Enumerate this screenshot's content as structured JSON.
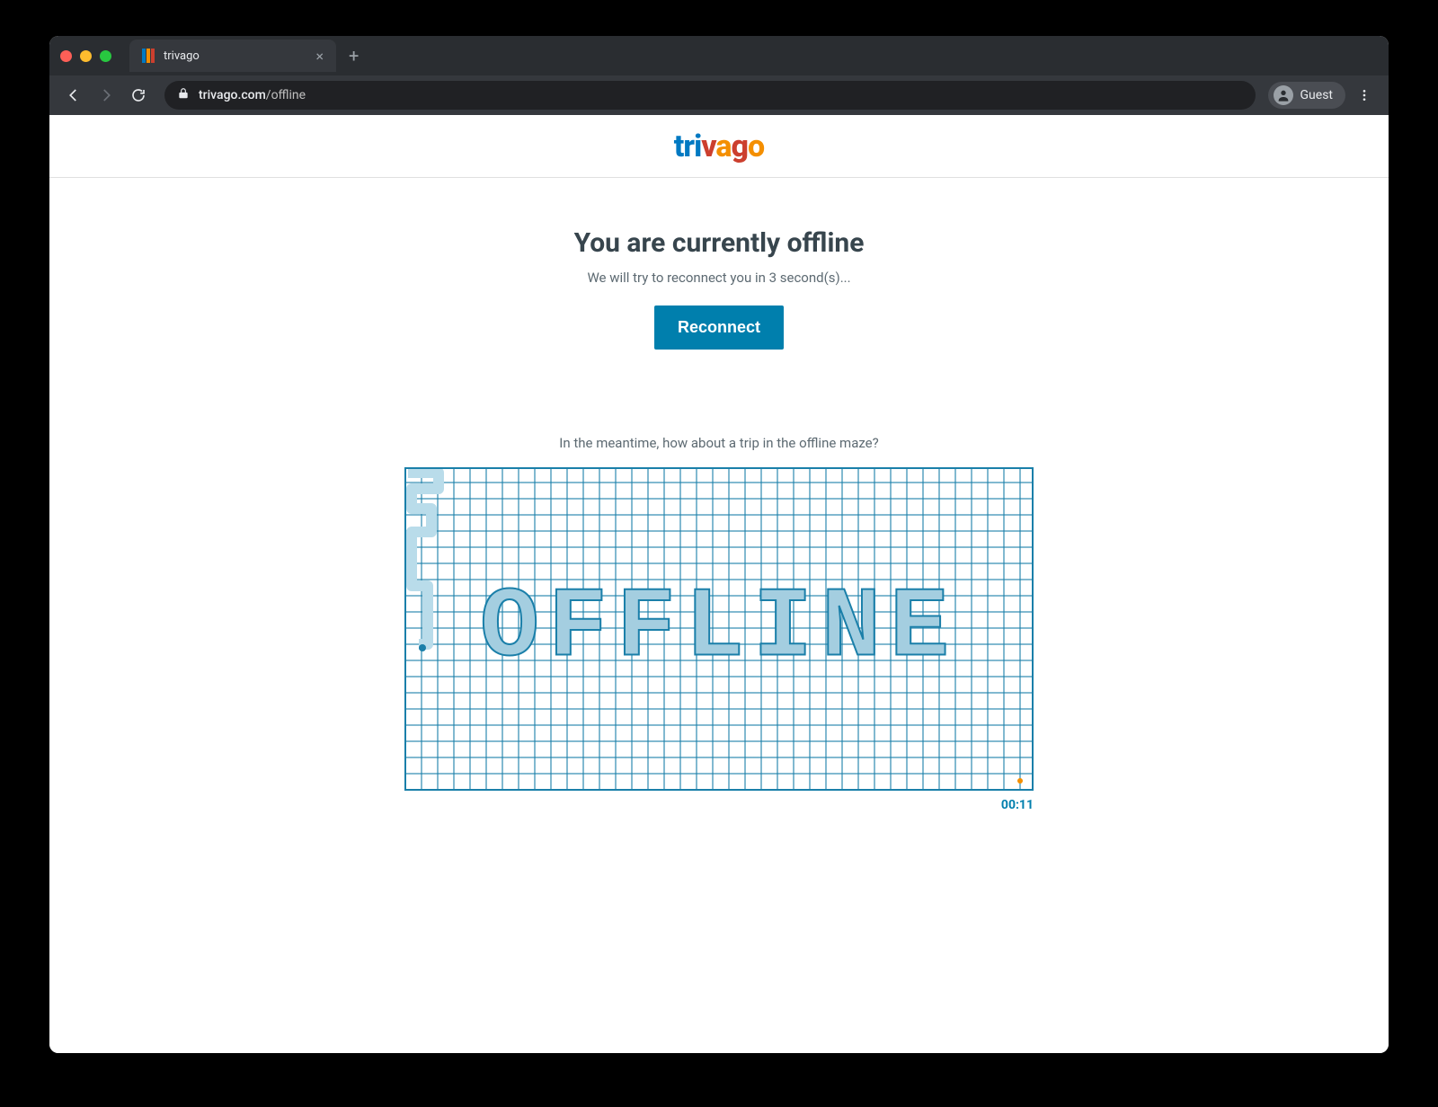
{
  "browser": {
    "tab_title": "trivago",
    "url_host": "trivago.com",
    "url_path": "/offline",
    "guest_label": "Guest"
  },
  "logo": {
    "t1": "tri",
    "t2": "v",
    "t3": "a",
    "t4": "g",
    "t5": "o"
  },
  "offline": {
    "heading": "You are currently offline",
    "subtitle": "We will try to reconnect you in 3 second(s)...",
    "button_label": "Reconnect",
    "maze_prompt": "In the meantime, how about a trip in the offline maze?",
    "maze_word": "OFFLINE",
    "timer": "00:11"
  }
}
